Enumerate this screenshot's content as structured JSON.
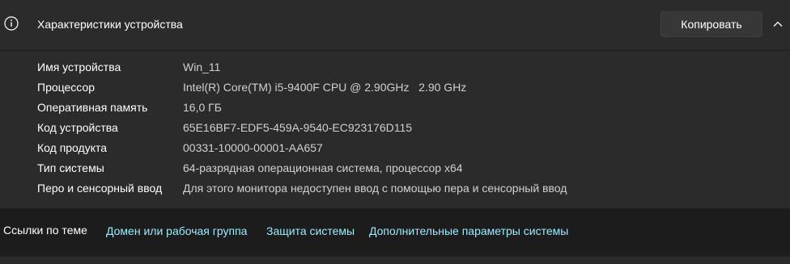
{
  "header": {
    "icon": "info-icon",
    "title": "Характеристики устройства",
    "copy_label": "Копировать",
    "collapse_icon": "chevron-up-icon"
  },
  "specs": [
    {
      "label": "Имя устройства",
      "value": "Win_11"
    },
    {
      "label": "Процессор",
      "value": "Intel(R) Core(TM) i5-9400F CPU @ 2.90GHz   2.90 GHz"
    },
    {
      "label": "Оперативная память",
      "value": "16,0 ГБ"
    },
    {
      "label": "Код устройства",
      "value": "65E16BF7-EDF5-459A-9540-EC923176D115"
    },
    {
      "label": "Код продукта",
      "value": "00331-10000-00001-AA657"
    },
    {
      "label": "Тип системы",
      "value": "64-разрядная операционная система, процессор x64"
    },
    {
      "label": "Перо и сенсорный ввод",
      "value": "Для этого монитора недоступен ввод с помощью пера и сенсорный ввод"
    }
  ],
  "related": {
    "title": "Ссылки по теме",
    "links": [
      "Домен или рабочая группа",
      "Защита системы",
      "Дополнительные параметры системы"
    ]
  },
  "colors": {
    "card_bg": "#2b2b2b",
    "page_bg": "#1c1c1c",
    "link": "#99ebff",
    "value_text": "#d0d0d0"
  }
}
